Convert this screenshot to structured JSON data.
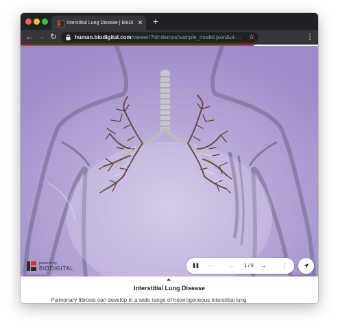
{
  "browser": {
    "tab_title": "Interstitial Lung Disease | BioDi",
    "tab_close": "✕",
    "new_tab": "+",
    "url_host": "human.biodigital.com",
    "url_path": "/viewer/?id=demos/sample_model.json&ui-…",
    "back": "←",
    "forward": "→",
    "reload": "↻",
    "bookmark": "☆",
    "menu": "⋮",
    "accent_color": "#d9322d"
  },
  "viewer": {
    "brand_tagline": "powered by",
    "brand_name": "BIODIGITAL",
    "controls": {
      "pause": "❚❚",
      "zoom_out": "—",
      "prev": "←",
      "counter": "1 / 6",
      "next": "→",
      "more": "⋮"
    },
    "background_color": "#b3a3d6"
  },
  "info": {
    "title": "Interstitial Lung Disease",
    "text": "Pulmonary fibrosis can develop in a wide range of heterogeneous interstitial lung"
  }
}
